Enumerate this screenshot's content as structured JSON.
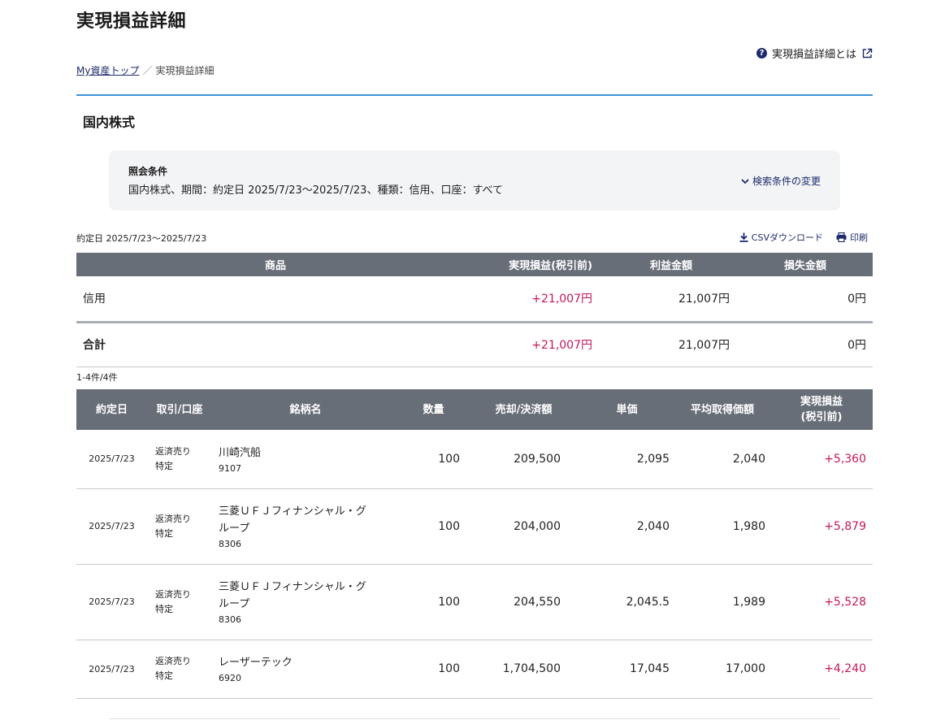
{
  "page": {
    "title": "実現損益詳細",
    "help_link": "実現損益詳細とは"
  },
  "breadcrumb": {
    "home": "My資産トップ",
    "separator": "／",
    "current": "実現損益詳細"
  },
  "section": {
    "title": "国内株式"
  },
  "conditions": {
    "label": "照会条件",
    "text": "国内株式、期間：約定日 2025/7/23〜2025/7/23、種類：信用、口座：すべて",
    "change_label": "検索条件の変更"
  },
  "period_text": "約定日 2025/7/23〜2025/7/23",
  "tools": {
    "csv_label": "CSVダウンロード",
    "print_label": "印刷"
  },
  "summary": {
    "headers": {
      "product": "商品",
      "realized": "実現損益(税引前)",
      "profit": "利益金額",
      "loss": "損失金額"
    },
    "rows": [
      {
        "product": "信用",
        "realized": "+21,007円",
        "profit": "21,007円",
        "loss": "0円"
      }
    ],
    "total": {
      "label": "合計",
      "realized": "+21,007円",
      "profit": "21,007円",
      "loss": "0円"
    }
  },
  "count_text": "1-4件/4件",
  "detail": {
    "headers": {
      "date": "約定日",
      "type": "取引/口座",
      "name": "銘柄名",
      "qty": "数量",
      "amount": "売却/決済額",
      "price": "単価",
      "avg": "平均取得価額",
      "realized_line1": "実現損益",
      "realized_line2": "(税引前)"
    },
    "rows": [
      {
        "date": "2025/7/23",
        "trade": "返済売り",
        "account": "特定",
        "name_line1": "川崎汽船",
        "name_line2": "",
        "code": "9107",
        "qty": "100",
        "amount": "209,500",
        "price": "2,095",
        "avg": "2,040",
        "realized": "+5,360"
      },
      {
        "date": "2025/7/23",
        "trade": "返済売り",
        "account": "特定",
        "name_line1": "三菱ＵＦＪフィナンシャル・グ",
        "name_line2": "ループ",
        "code": "8306",
        "qty": "100",
        "amount": "204,000",
        "price": "2,040",
        "avg": "1,980",
        "realized": "+5,879"
      },
      {
        "date": "2025/7/23",
        "trade": "返済売り",
        "account": "特定",
        "name_line1": "三菱ＵＦＪフィナンシャル・グ",
        "name_line2": "ループ",
        "code": "8306",
        "qty": "100",
        "amount": "204,550",
        "price": "2,045.5",
        "avg": "1,989",
        "realized": "+5,528"
      },
      {
        "date": "2025/7/23",
        "trade": "返済売り",
        "account": "特定",
        "name_line1": "レーザーテック",
        "name_line2": "",
        "code": "6920",
        "qty": "100",
        "amount": "1,704,500",
        "price": "17,045",
        "avg": "17,000",
        "realized": "+4,240"
      }
    ]
  },
  "colors": {
    "accent_rule": "#3b93d6",
    "header_bg": "#686e78",
    "positive": "#c2185b",
    "link": "#1d2b6b"
  }
}
